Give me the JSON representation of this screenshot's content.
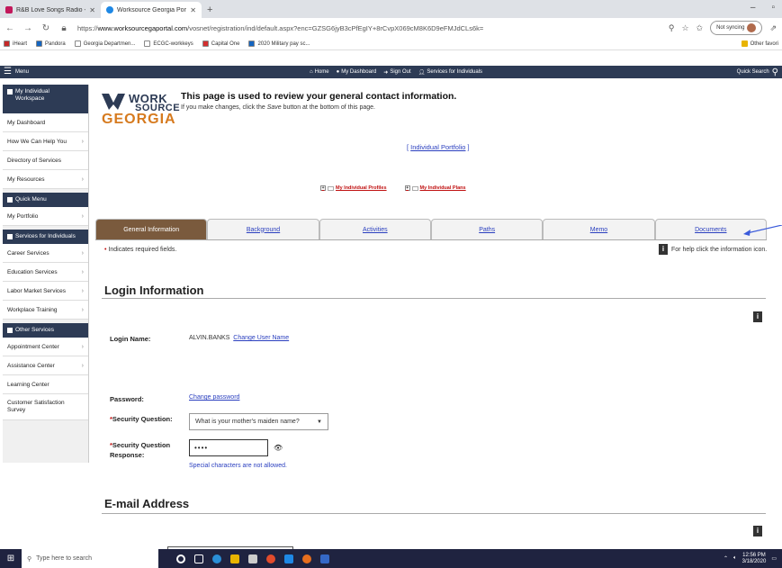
{
  "browser": {
    "tabs": [
      {
        "title": "R&B Love Songs Radio - Fr",
        "fav_color": "#c2185b"
      },
      {
        "title": "Worksource Georgia Portal - Reg",
        "fav_color": "#1e88e5"
      }
    ],
    "url_prefix": "https://",
    "url_domain": "www.worksourcegaportal.com",
    "url_path": "/vosnet/registration/ind/default.aspx?enc=GZSG6jyB3cPfEgIY+8rCvpX069cM8K6D9eFMJdCLs6k=",
    "sync_label": "Not syncing",
    "bookmarks": [
      {
        "label": "iHeart",
        "color": "#c62828"
      },
      {
        "label": "Pandora",
        "color": "#1565c0"
      },
      {
        "label": "Georgia Departmen...",
        "color": "#ffffff"
      },
      {
        "label": "ECGC-workkeys",
        "color": "#ffffff"
      },
      {
        "label": "Capital One",
        "color": "#d32f2f"
      },
      {
        "label": "2020 Military pay sc...",
        "color": "#1565c0"
      }
    ],
    "other_favorites": "Other favori"
  },
  "sitenav": {
    "menu": "Menu",
    "home": "Home",
    "dashboard": "My Dashboard",
    "signout": "Sign Out",
    "services": "Services for Individuals",
    "quick_search": "Quick Search"
  },
  "sidebar": {
    "sections": [
      {
        "title": "My Individual Workspace",
        "items": [
          {
            "label": "My Dashboard",
            "chev": false
          },
          {
            "label": "How We Can Help You",
            "chev": true
          },
          {
            "label": "Directory of Services",
            "chev": false
          },
          {
            "label": "My Resources",
            "chev": true
          }
        ]
      },
      {
        "title": "Quick Menu",
        "items": [
          {
            "label": "My Portfolio",
            "chev": true
          }
        ]
      },
      {
        "title": "Services for Individuals",
        "items": [
          {
            "label": "Career Services",
            "chev": true
          },
          {
            "label": "Education Services",
            "chev": true
          },
          {
            "label": "Labor Market Services",
            "chev": true
          },
          {
            "label": "Workplace Training",
            "chev": true
          }
        ]
      },
      {
        "title": "Other Services",
        "items": [
          {
            "label": "Appointment Center",
            "chev": true
          },
          {
            "label": "Assistance Center",
            "chev": true
          },
          {
            "label": "Learning Center",
            "chev": false
          },
          {
            "label": "Customer Satisfaction Survey",
            "chev": false
          }
        ]
      }
    ]
  },
  "logo": {
    "line1": "WORK",
    "line2": "SOURCE",
    "line3": "GEORGIA"
  },
  "intro": {
    "title": "This page is used to review your general contact information.",
    "sub_before": "If you make changes, click the ",
    "sub_em": "Save",
    "sub_after": " button at the bottom of this page."
  },
  "portfolio": {
    "open": "[ ",
    "link": "Individual Portfolio",
    "close": " ]"
  },
  "profile_links": [
    "My Individual Profiles",
    "My Individual Plans"
  ],
  "tabs": [
    "General Information",
    "Background",
    "Activities",
    "Paths",
    "Memo",
    "Documents"
  ],
  "active_tab": 0,
  "required_note": "Indicates required fields.",
  "required_dot": "•",
  "help_text": "For help click the information icon.",
  "info_glyph": "i",
  "login": {
    "title": "Login Information",
    "name_label": "Login Name:",
    "name_value": "ALVIN.BANKS",
    "change_name": "Change User Name",
    "password_label": "Password:",
    "change_password": "Change password",
    "question_label": "Security Question:",
    "question_value": "What is your mother's maiden name?",
    "response_label": "Security Question Response:",
    "response_value": "••••",
    "special_note": "Special characters are not allowed.",
    "required_star": "*"
  },
  "email": {
    "title": "E-mail Address"
  },
  "taskbar": {
    "search_placeholder": "Type here to search",
    "time": "12:56 PM",
    "date": "3/18/2020"
  }
}
